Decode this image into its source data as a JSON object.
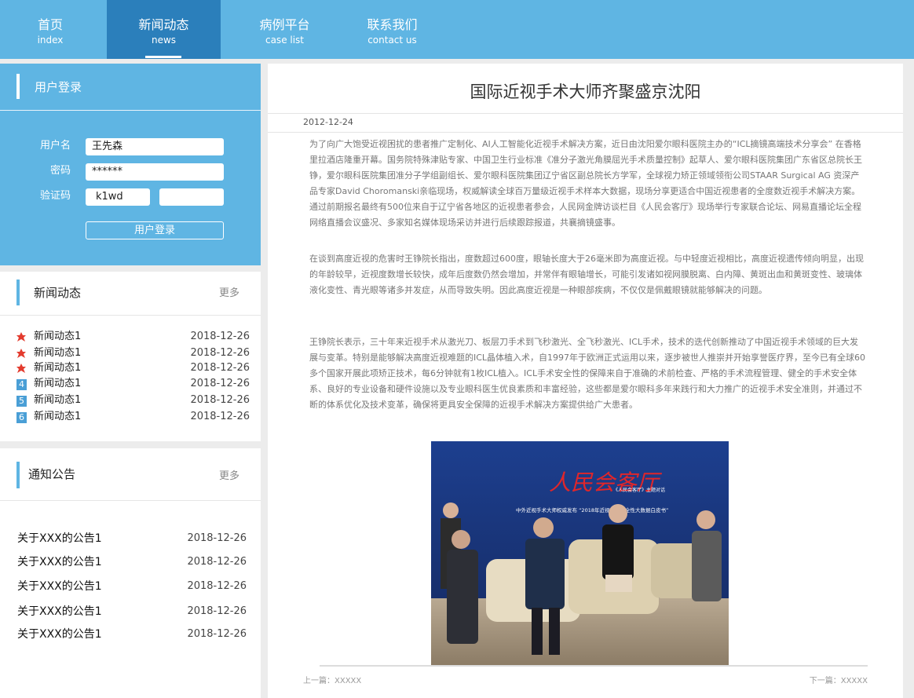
{
  "nav": [
    {
      "cn": "首页",
      "en": "index"
    },
    {
      "cn": "新闻动态",
      "en": "news"
    },
    {
      "cn": "病例平台",
      "en": "case list"
    },
    {
      "cn": "联系我们",
      "en": "contact us"
    }
  ],
  "login": {
    "title": "用户登录",
    "username_label": "用户名",
    "username_value": "王先森",
    "password_label": "密码",
    "password_value": "******",
    "captcha_label": "验证码",
    "captcha_code": "k1wd",
    "captcha_value": "",
    "button": "用户登录"
  },
  "news": {
    "title": "新闻动态",
    "more": "更多",
    "items": [
      {
        "badge": "hot",
        "title": "新闻动态1",
        "date": "2018-12-26"
      },
      {
        "badge": "hot",
        "title": "新闻动态1",
        "date": "2018-12-26"
      },
      {
        "badge": "hot",
        "title": "新闻动态1",
        "date": "2018-12-26"
      },
      {
        "badge": "4",
        "title": "新闻动态1",
        "date": "2018-12-26"
      },
      {
        "badge": "5",
        "title": "新闻动态1",
        "date": "2018-12-26"
      },
      {
        "badge": "6",
        "title": "新闻动态1",
        "date": "2018-12-26"
      }
    ]
  },
  "notice": {
    "title": "通知公告",
    "more": "更多",
    "items": [
      {
        "title": "关于XXX的公告1",
        "date": "2018-12-26"
      },
      {
        "title": "关于XXX的公告1",
        "date": "2018-12-26"
      },
      {
        "title": "关于XXX的公告1",
        "date": "2018-12-26"
      },
      {
        "title": "关于XXX的公告1",
        "date": "2018-12-26"
      },
      {
        "title": "关于XXX的公告1",
        "date": "2018-12-26"
      }
    ]
  },
  "article": {
    "title": "国际近视手术大师齐聚盛京沈阳",
    "date": "2012-12-24",
    "paragraphs": [
      " 为了向广大饱受近视困扰的患者推广定制化、AI人工智能化近视手术解决方案，近日由沈阳爱尔眼科医院主办的“ICL摘镜高端技术分享会” 在香格里拉酒店隆重开幕。国务院特殊津贴专家、中国卫生行业标准《准分子激光角膜屈光手术质量控制》起草人、爱尔眼科医院集团广东省区总院长王铮，爱尔眼科医院集团准分子学组副组长、爱尔眼科医院集团辽宁省区副总院长方学军，全球视力矫正领域领衔公司STAAR Surgical AG 资深产品专家David Choromanski亲临现场，权威解读全球百万量级近视手术样本大数据，现场分享更适合中国近视患者的全度数近视手术解决方案。通过前期报名最终有500位来自于辽宁省各地区的近视患者参会，人民网金牌访谈栏目《人民会客厅》现场举行专家联合论坛、网易直播论坛全程网络直播会议盛况、多家知名媒体现场采访并进行后续跟踪报道，共襄摘镜盛事。",
      " 在谈到高度近视的危害时王铮院长指出，度数超过600度，眼轴长度大于26毫米即为高度近视。与中轻度近视相比，高度近视遗传倾向明显，出现的年龄较早，近视度数增长较快，成年后度数仍然会增加，并常伴有眼轴增长，可能引发诸如视网膜脱离、白内障、黄斑出血和黄斑变性、玻璃体液化变性、青光眼等诸多并发症，从而导致失明。因此高度近视是一种眼部疾病，不仅仅是佩戴眼镜就能够解决的问题。",
      "王铮院长表示，三十年来近视手术从激光刀、板层刀手术到飞秒激光、全飞秒激光、ICL手术，技术的迭代创新推动了中国近视手术领域的巨大发展与变革。特别是能够解决高度近视难题的ICL晶体植入术，自1997年于欧洲正式运用以来，逐步被世人推崇并开始享誉医疗界，至今已有全球60多个国家开展此项矫正技术，每6分钟就有1枚ICL植入。ICL手术安全性的保障来自于准确的术前检查、严格的手术流程管理、健全的手术安全体系、良好的专业设备和硬件设施以及专业眼科医生优良素质和丰富经验，这些都是爱尔眼科多年来践行和大力推广的近视手术安全准则，并通过不断的体系优化及技术变革，确保将更具安全保障的近视手术解决方案提供给广大患者。"
    ],
    "photo": {
      "banner_main": "人民会客厅",
      "banner_sub": "《人民会客厅》主题对话",
      "banner_line": "中外近视手术大师权威发布 “2018年近视手术中全性大数据白皮书”"
    },
    "prev": "上一篇：XXXXX",
    "next": "下一篇：XXXXX"
  },
  "colors": {
    "nav_bg": "#5fb5e3",
    "nav_active": "#2b7fbb",
    "hot_icon": "#e33b2e",
    "num_badge": "#4a9fd6"
  }
}
